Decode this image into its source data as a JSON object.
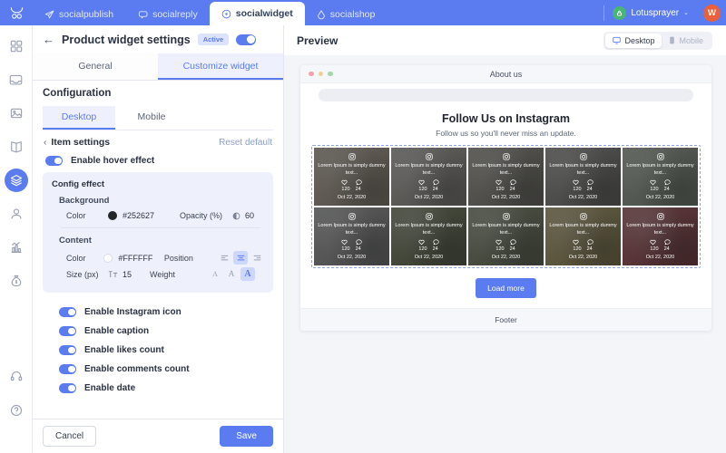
{
  "topnav": {
    "logo_icon": "bull-logo-icon",
    "tabs": [
      {
        "label": "socialpublish",
        "icon": "paper-plane-icon",
        "active": false
      },
      {
        "label": "socialreply",
        "icon": "chat-bubble-icon",
        "active": false
      },
      {
        "label": "socialwidget",
        "icon": "widget-circle-icon",
        "active": true
      },
      {
        "label": "socialshop",
        "icon": "tag-icon",
        "active": false
      }
    ],
    "account": {
      "name": "Lotusprayer",
      "badge_icon": "lock-icon",
      "caret": "⌄"
    },
    "avatar_letter": "W",
    "brand_color": "#5b7cf0"
  },
  "rail": {
    "items": [
      {
        "name": "dashboard-icon",
        "selected": false
      },
      {
        "name": "inbox-icon",
        "selected": false
      },
      {
        "name": "image-icon",
        "selected": false
      },
      {
        "name": "book-icon",
        "selected": false
      },
      {
        "name": "layers-icon",
        "selected": true
      },
      {
        "name": "user-icon",
        "selected": false
      },
      {
        "name": "analytics-icon",
        "selected": false
      },
      {
        "name": "money-bag-icon",
        "selected": false
      }
    ],
    "bottom": [
      {
        "name": "headset-icon",
        "selected": false
      },
      {
        "name": "help-icon",
        "selected": false
      }
    ]
  },
  "page": {
    "back_arrow": "←",
    "title": "Product widget settings",
    "status_badge": "Active",
    "status_enabled": true,
    "tabs": [
      {
        "label": "General",
        "active": false
      },
      {
        "label": "Customize widget",
        "active": true
      }
    ]
  },
  "config": {
    "heading": "Configuration",
    "device_tabs": [
      {
        "label": "Desktop",
        "active": true
      },
      {
        "label": "Mobile",
        "active": false
      }
    ],
    "item_settings": {
      "chevron": "‹",
      "title": "Item settings",
      "reset_label": "Reset default"
    },
    "hover_effect": {
      "label": "Enable hover effect",
      "enabled": true
    },
    "config_effect": {
      "title": "Config effect",
      "background": {
        "group_label": "Background",
        "color_label": "Color",
        "color_value": "#252627",
        "opacity_label": "Opacity (%)",
        "opacity_icon": "opacity-icon",
        "opacity_value": "60"
      },
      "content": {
        "group_label": "Content",
        "color_label": "Color",
        "color_value": "#FFFFFF",
        "position_label": "Position",
        "position_options": [
          "align-left-icon",
          "align-center-icon",
          "align-right-icon"
        ],
        "position_selected": 1,
        "size_label": "Size (px)",
        "size_icon": "font-size-icon",
        "size_value": "15",
        "weight_label": "Weight",
        "weight_options": [
          "A",
          "A",
          "A"
        ],
        "weight_selected": 2
      }
    },
    "toggles": [
      {
        "label": "Enable Instagram icon",
        "enabled": true
      },
      {
        "label": "Enable caption",
        "enabled": true
      },
      {
        "label": "Enable likes count",
        "enabled": true
      },
      {
        "label": "Enable comments count",
        "enabled": true
      },
      {
        "label": "Enable date",
        "enabled": true
      }
    ],
    "footer": {
      "cancel_label": "Cancel",
      "save_label": "Save"
    }
  },
  "preview": {
    "title": "Preview",
    "devices": [
      {
        "label": "Desktop",
        "icon": "monitor-icon",
        "active": true
      },
      {
        "label": "Mobile",
        "icon": "phone-icon",
        "active": false
      }
    ],
    "browser": {
      "tab_title": "About us",
      "widget_title": "Follow Us on Instagram",
      "widget_subtitle": "Follow us so you'll never miss an update.",
      "load_more_label": "Load more",
      "footer_label": "Footer"
    },
    "tiles": [
      {
        "caption": "Lorem Ipsum is simply dummy text...",
        "likes": "120",
        "comments": "24",
        "date": "Oct 22, 2020",
        "bg": "#c8b49c"
      },
      {
        "caption": "Lorem Ipsum is simply dummy text...",
        "likes": "120",
        "comments": "24",
        "date": "Oct 22, 2020",
        "bg": "#bcb6ad"
      },
      {
        "caption": "Lorem Ipsum is simply dummy text...",
        "likes": "120",
        "comments": "24",
        "date": "Oct 22, 2020",
        "bg": "#9a9488"
      },
      {
        "caption": "Lorem Ipsum is simply dummy text...",
        "likes": "120",
        "comments": "24",
        "date": "Oct 22, 2020",
        "bg": "#8e8b84"
      },
      {
        "caption": "Lorem Ipsum is simply dummy text...",
        "likes": "120",
        "comments": "24",
        "date": "Oct 22, 2020",
        "bg": "#a3b09a"
      },
      {
        "caption": "Lorem Ipsum is simply dummy text...",
        "likes": "120",
        "comments": "24",
        "date": "Oct 22, 2020",
        "bg": "#a9a9a5"
      },
      {
        "caption": "Lorem Ipsum is simply dummy text...",
        "likes": "120",
        "comments": "24",
        "date": "Oct 22, 2020",
        "bg": "#6f7a4f"
      },
      {
        "caption": "Lorem Ipsum is simply dummy text...",
        "likes": "120",
        "comments": "24",
        "date": "Oct 22, 2020",
        "bg": "#7e8a64"
      },
      {
        "caption": "Lorem Ipsum is simply dummy text...",
        "likes": "120",
        "comments": "24",
        "date": "Oct 22, 2020",
        "bg": "#c2ab5a"
      },
      {
        "caption": "Lorem Ipsum is simply dummy text...",
        "likes": "120",
        "comments": "24",
        "date": "Oct 22, 2020",
        "bg": "#b33a44"
      }
    ],
    "icons": {
      "instagram": "instagram-icon",
      "like": "heart-icon",
      "comment": "comment-icon"
    }
  }
}
